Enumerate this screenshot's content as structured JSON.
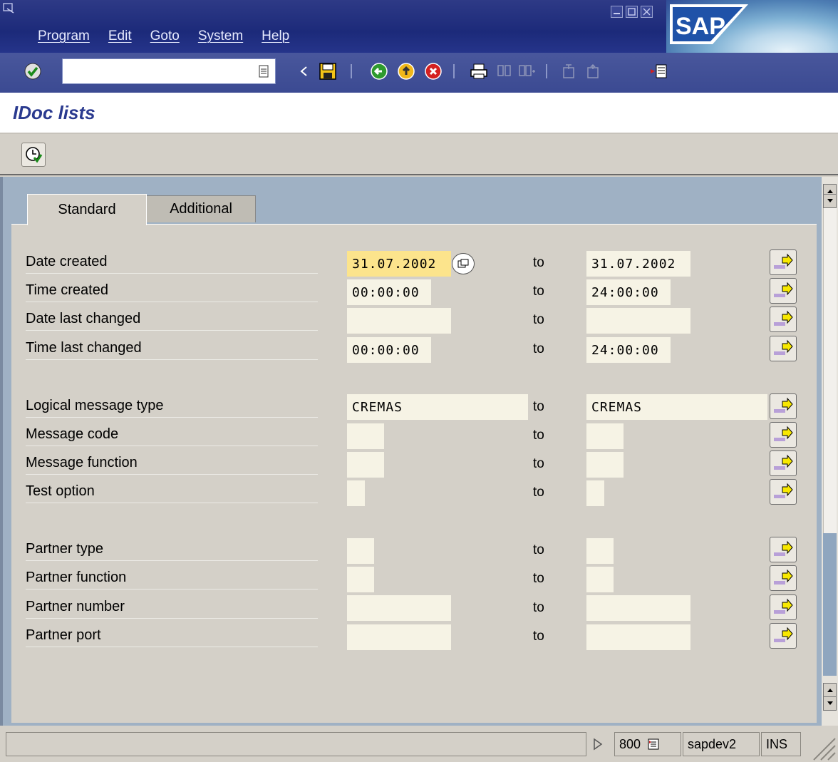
{
  "menu": [
    "Program",
    "Edit",
    "Goto",
    "System",
    "Help"
  ],
  "toolbar": {
    "command_value": "",
    "icons": [
      "enter-icon",
      "command-history-icon",
      "back-arrow-icon",
      "save-icon",
      "back-icon",
      "exit-icon",
      "cancel-icon",
      "print-icon",
      "find-icon",
      "find-next-icon",
      "first-page-icon",
      "previous-page-icon",
      "create-session-icon"
    ]
  },
  "screen": {
    "title": "IDoc lists"
  },
  "tabs": {
    "standard": "Standard",
    "additional": "Additional"
  },
  "to_label": "to",
  "rows": [
    {
      "label": "Date created",
      "from": "31.07.2002",
      "to": "31.07.2002"
    },
    {
      "label": "Time created",
      "from": "00:00:00",
      "to": "24:00:00"
    },
    {
      "label": "Date last changed",
      "from": "",
      "to": ""
    },
    {
      "label": "Time last changed",
      "from": "00:00:00",
      "to": "24:00:00"
    },
    {
      "label": "Logical message type",
      "from": "CREMAS",
      "to": "CREMAS"
    },
    {
      "label": "Message code",
      "from": "",
      "to": ""
    },
    {
      "label": "Message function",
      "from": "",
      "to": ""
    },
    {
      "label": "Test option",
      "from": "",
      "to": ""
    },
    {
      "label": "Partner type",
      "from": "",
      "to": ""
    },
    {
      "label": "Partner function",
      "from": "",
      "to": ""
    },
    {
      "label": "Partner number",
      "from": "",
      "to": ""
    },
    {
      "label": "Partner port",
      "from": "",
      "to": ""
    }
  ],
  "status": {
    "client": "800",
    "server": "sapdev2",
    "mode": "INS"
  },
  "colors": {
    "title_blue": "#2a3a8f",
    "active_field": "#fce48c",
    "input_field": "#f6f3e5"
  }
}
